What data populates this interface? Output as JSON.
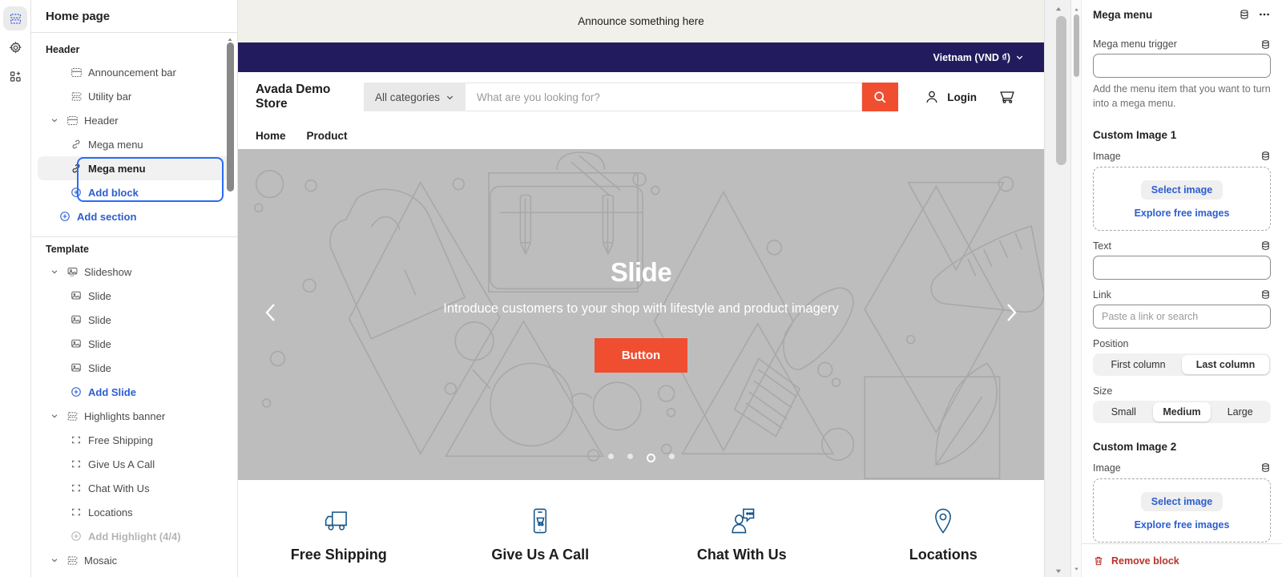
{
  "rail": {
    "items": [
      {
        "name": "sections-icon",
        "active": true
      },
      {
        "name": "settings-gear-icon",
        "active": false
      },
      {
        "name": "apps-blocks-icon",
        "active": false
      }
    ]
  },
  "sidebar": {
    "title": "Home page",
    "groups": [
      {
        "label": "Header",
        "items": [
          {
            "label": "Announcement bar",
            "icon": "section-bar-icon",
            "level": 1,
            "type": "section"
          },
          {
            "label": "Utility bar",
            "icon": "section-stack-icon",
            "level": 1,
            "type": "section"
          },
          {
            "label": "Header",
            "icon": "section-bar-icon",
            "level": 1,
            "type": "section",
            "caret": true
          },
          {
            "label": "Mega menu",
            "icon": "link-icon",
            "level": 2,
            "type": "block"
          },
          {
            "label": "Mega menu",
            "icon": "link-icon",
            "level": 2,
            "type": "block",
            "selected": true
          },
          {
            "label": "Add block",
            "icon": "plus-circle-icon",
            "level": 2,
            "type": "add"
          },
          {
            "label": "Add section",
            "icon": "plus-circle-icon",
            "level": 1,
            "type": "add"
          }
        ]
      },
      {
        "label": "Template",
        "items": [
          {
            "label": "Slideshow",
            "icon": "slideshow-icon",
            "level": 1,
            "type": "section",
            "caret": true
          },
          {
            "label": "Slide",
            "icon": "image-icon",
            "level": 2,
            "type": "block"
          },
          {
            "label": "Slide",
            "icon": "image-icon",
            "level": 2,
            "type": "block"
          },
          {
            "label": "Slide",
            "icon": "image-icon",
            "level": 2,
            "type": "block"
          },
          {
            "label": "Slide",
            "icon": "image-icon",
            "level": 2,
            "type": "block"
          },
          {
            "label": "Add Slide",
            "icon": "plus-circle-icon",
            "level": 2,
            "type": "add"
          },
          {
            "label": "Highlights banner",
            "icon": "section-stack-icon",
            "level": 1,
            "type": "section",
            "caret": true
          },
          {
            "label": "Free Shipping",
            "icon": "block-corners-icon",
            "level": 2,
            "type": "block"
          },
          {
            "label": "Give Us A Call",
            "icon": "block-corners-icon",
            "level": 2,
            "type": "block"
          },
          {
            "label": "Chat With Us",
            "icon": "block-corners-icon",
            "level": 2,
            "type": "block"
          },
          {
            "label": "Locations",
            "icon": "block-corners-icon",
            "level": 2,
            "type": "block"
          },
          {
            "label": "Add Highlight (4/4)",
            "icon": "plus-circle-icon",
            "level": 2,
            "type": "add",
            "disabled": true
          },
          {
            "label": "Mosaic",
            "icon": "section-stack-icon",
            "level": 1,
            "type": "section",
            "caret": true
          }
        ]
      }
    ]
  },
  "preview": {
    "announcement": "Announce something here",
    "utility": {
      "currency": "Vietnam (VND ₫)"
    },
    "header": {
      "logo": "Avada Demo Store",
      "categories": "All categories",
      "search_placeholder": "What are you looking for?",
      "login": "Login",
      "cart_icon": "shopping-cart-icon",
      "search_icon": "search-icon",
      "account_icon": "user-account-icon"
    },
    "nav": [
      "Home",
      "Product"
    ],
    "hero": {
      "heading": "Slide",
      "subheading": "Introduce customers to your shop with lifestyle and product imagery",
      "button": "Button",
      "prev_icon": "chevron-left-icon",
      "next_icon": "chevron-right-icon",
      "dots": 4,
      "active_dot": 3
    },
    "highlights": [
      {
        "label": "Free Shipping",
        "icon": "delivery-truck-icon"
      },
      {
        "label": "Give Us A Call",
        "icon": "mobile-phone-icon"
      },
      {
        "label": "Chat With Us",
        "icon": "chat-person-icon"
      },
      {
        "label": "Locations",
        "icon": "map-pin-icon"
      }
    ]
  },
  "right_panel": {
    "title": "Mega menu",
    "header_icons": [
      "dynamic-source-icon",
      "more-options-icon"
    ],
    "fields": [
      {
        "kind": "input",
        "label": "Mega menu trigger",
        "value": "",
        "placeholder": "",
        "dynamic": true
      },
      {
        "kind": "helper",
        "text": "Add the menu item that you want to turn into a mega menu."
      },
      {
        "kind": "section",
        "label": "Custom Image 1"
      },
      {
        "kind": "image",
        "label": "Image",
        "select": "Select image",
        "explore": "Explore free images",
        "dynamic": true
      },
      {
        "kind": "input",
        "label": "Text",
        "value": "",
        "placeholder": "",
        "dynamic": true
      },
      {
        "kind": "input",
        "label": "Link",
        "value": "",
        "placeholder": "Paste a link or search",
        "dynamic": true
      },
      {
        "kind": "segmented",
        "label": "Position",
        "options": [
          "First column",
          "Last column"
        ],
        "selected": "Last column"
      },
      {
        "kind": "segmented",
        "label": "Size",
        "options": [
          "Small",
          "Medium",
          "Large"
        ],
        "selected": "Medium"
      },
      {
        "kind": "section",
        "label": "Custom Image 2"
      },
      {
        "kind": "image",
        "label": "Image",
        "select": "Select image",
        "explore": "Explore free images",
        "dynamic": true
      }
    ],
    "remove": "Remove block"
  },
  "colors": {
    "accent_blue": "#2c5ecf",
    "selection_blue": "#2b6cf6",
    "utility_navy": "#221c5e",
    "cta_orange": "#f04e30",
    "hero_gray": "#bdbdbd",
    "highlight_icon": "#13548a",
    "remove_red": "#b8332a"
  }
}
